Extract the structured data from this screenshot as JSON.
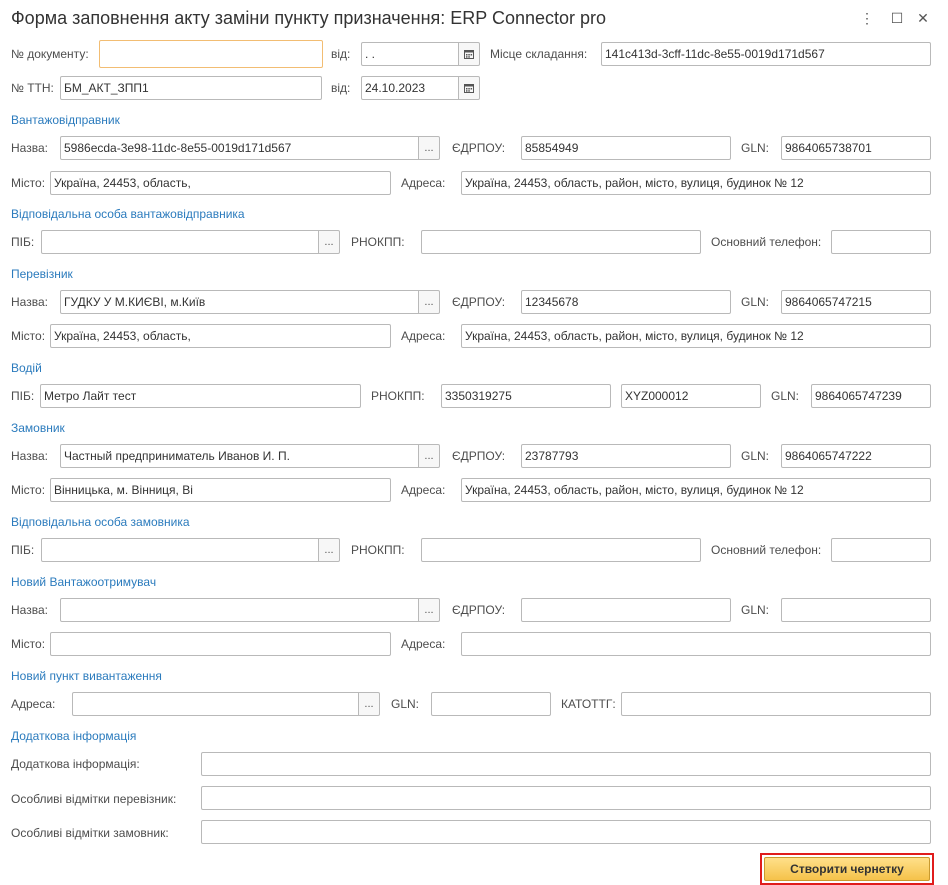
{
  "window": {
    "title": "Форма заповнення акту заміни пункту призначення: ERP Connector pro",
    "more_glyph": "⋮",
    "maximize_glyph": "☐",
    "close_glyph": "✕"
  },
  "header": {
    "doc_no_label": "№ документу:",
    "doc_no_value": "",
    "doc_date_label": "від:",
    "doc_date_value": " .  .",
    "place_label": "Місце складання:",
    "place_value": "141c413d-3cff-11dc-8e55-0019d171d567",
    "ttn_label": "№ ТТН:",
    "ttn_value": "БМ_АКТ_ЗПП1",
    "ttn_date_label": "від:",
    "ttn_date_value": "24.10.2023"
  },
  "shipper": {
    "section": "Вантажовідправник",
    "name_label": "Назва:",
    "name_value": "5986ecda-3e98-11dc-8e55-0019d171d567",
    "edrpou_label": "ЄДРПОУ:",
    "edrpou_value": "85854949",
    "gln_label": "GLN:",
    "gln_value": "9864065738701",
    "city_label": "Місто:",
    "city_value": "Україна, 24453, область,",
    "address_label": "Адреса:",
    "address_value": "Україна, 24453, область, район, місто, вулиця, будинок № 12"
  },
  "shipper_person": {
    "section": "Відповідальна особа вантажовідправника",
    "pib_label": "ПІБ:",
    "pib_value": "",
    "rnokpp_label": "РНОКПП:",
    "rnokpp_value": "",
    "phone_label": "Основний телефон:",
    "phone_value": ""
  },
  "carrier": {
    "section": "Перевізник",
    "name_label": "Назва:",
    "name_value": "ГУДКУ У М.КИЄВІ, м.Київ",
    "edrpou_label": "ЄДРПОУ:",
    "edrpou_value": "12345678",
    "gln_label": "GLN:",
    "gln_value": "9864065747215",
    "city_label": "Місто:",
    "city_value": "Україна, 24453, область,",
    "address_label": "Адреса:",
    "address_value": "Україна, 24453, область, район, місто, вулиця, будинок № 12"
  },
  "driver": {
    "section": "Водій",
    "pib_label": "ПІБ:",
    "pib_value": "Метро Лайт тест",
    "rnokpp_label": "РНОКПП:",
    "rnokpp_value": "3350319275",
    "extra_value": "XYZ000012",
    "gln_label": "GLN:",
    "gln_value": "9864065747239"
  },
  "customer": {
    "section": "Замовник",
    "name_label": "Назва:",
    "name_value": "Частный предприниматель Иванов И. П.",
    "edrpou_label": "ЄДРПОУ:",
    "edrpou_value": "23787793",
    "gln_label": "GLN:",
    "gln_value": "9864065747222",
    "city_label": "Місто:",
    "city_value": "Вінницька, м. Вінниця, Ві",
    "address_label": "Адреса:",
    "address_value": "Україна, 24453, область, район, місто, вулиця, будинок № 12"
  },
  "customer_person": {
    "section": "Відповідальна особа замовника",
    "pib_label": "ПІБ:",
    "pib_value": "",
    "rnokpp_label": "РНОКПП:",
    "rnokpp_value": "",
    "phone_label": "Основний телефон:",
    "phone_value": ""
  },
  "new_consignee": {
    "section": "Новий Вантажоотримувач",
    "name_label": "Назва:",
    "name_value": "",
    "edrpou_label": "ЄДРПОУ:",
    "edrpou_value": "",
    "gln_label": "GLN:",
    "gln_value": "",
    "city_label": "Місто:",
    "city_value": "",
    "address_label": "Адреса:",
    "address_value": ""
  },
  "new_unload": {
    "section": "Новий пункт вивантаження",
    "address_label": "Адреса:",
    "address_value": "",
    "gln_label": "GLN:",
    "gln_value": "",
    "katottg_label": "КАТОТТГ:",
    "katottg_value": ""
  },
  "extra": {
    "section": "Додаткова інформація",
    "info_label": "Додаткова інформація:",
    "info_value": "",
    "carrier_marks_label": "Особливі відмітки перевізник:",
    "carrier_marks_value": "",
    "customer_marks_label": "Особливі відмітки замовник:",
    "customer_marks_value": ""
  },
  "buttons": {
    "select_glyph": "...",
    "create_draft": "Створити чернетку"
  }
}
